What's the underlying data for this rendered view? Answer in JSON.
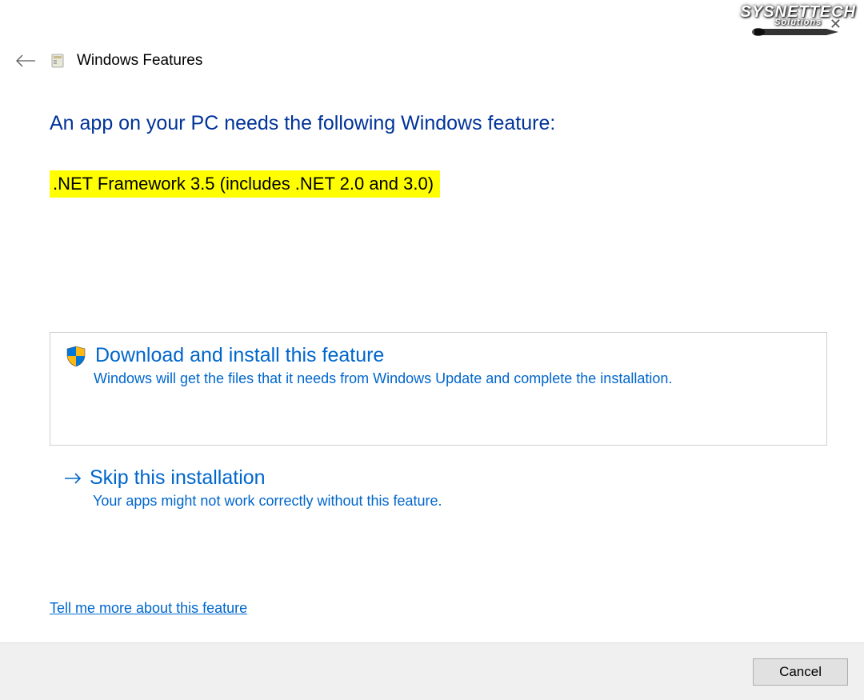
{
  "watermark": {
    "line1": "SYSNETTECH",
    "line2": "Solutions"
  },
  "header": {
    "title": "Windows Features"
  },
  "content": {
    "heading": "An app on your PC needs the following Windows feature:",
    "feature_name": ".NET Framework 3.5 (includes .NET 2.0 and 3.0)"
  },
  "options": {
    "download": {
      "title": "Download and install this feature",
      "description": "Windows will get the files that it needs from Windows Update and complete the installation."
    },
    "skip": {
      "title": "Skip this installation",
      "description": "Your apps might not work correctly without this feature."
    }
  },
  "link": {
    "tell_more": "Tell me more about this feature"
  },
  "footer": {
    "cancel_label": "Cancel"
  },
  "colors": {
    "accent": "#0066cc",
    "heading": "#003399",
    "highlight": "#ffff00"
  }
}
